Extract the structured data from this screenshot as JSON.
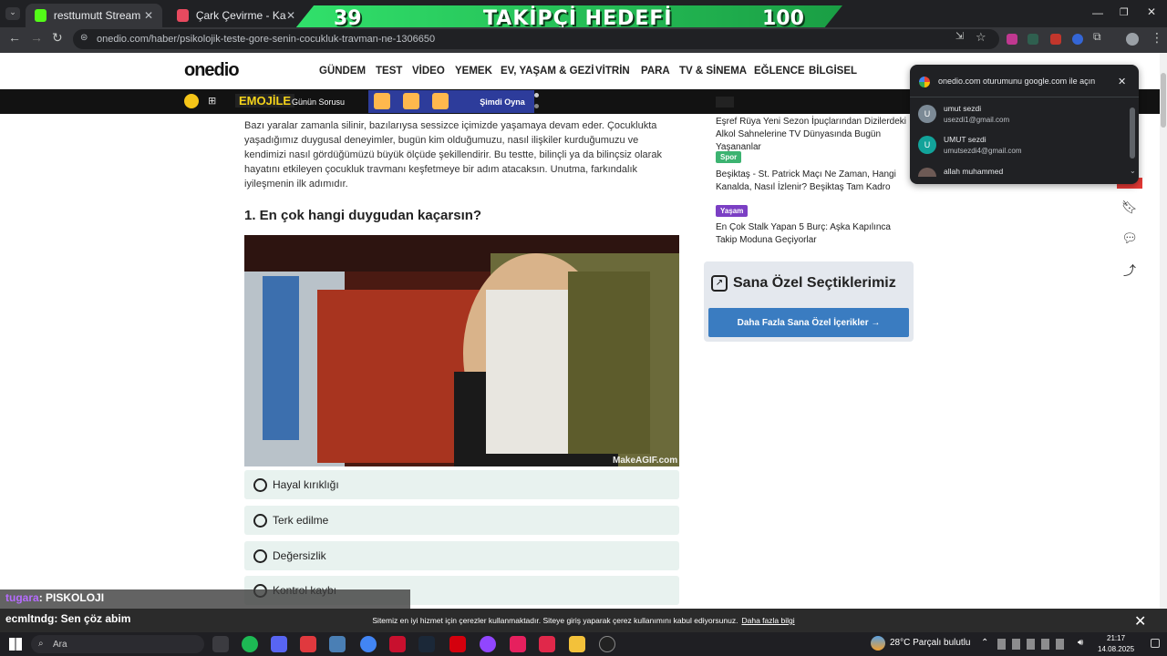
{
  "browser": {
    "tabs": [
      {
        "label": "resttumutt Stream - Watch Live",
        "favicon_color": "#53fc18"
      },
      {
        "label": "Çark Çevirme - Karar Çarkı",
        "favicon_color": "#e84a5f"
      }
    ],
    "url": "onedio.com/haber/psikolojik-teste-gore-senin-cocukluk-travman-ne-1306650"
  },
  "overlay": {
    "current": "39",
    "label": "TAKİPÇİ HEDEFİ",
    "target": "100"
  },
  "site": {
    "logo": "onedio",
    "nav": [
      "GÜNDEM",
      "TEST",
      "VİDEO",
      "YEMEK",
      "EV, YAŞAM & GEZİ",
      "VİTRİN",
      "PARA",
      "TV & SİNEMA",
      "EĞLENCE",
      "BİLGİSEL"
    ],
    "subbar": {
      "emojile": "EMOJİLE",
      "gunun": "Günün Sorusu",
      "play": "Şimdi Oyna"
    }
  },
  "article": {
    "intro": "Bazı yaralar zamanla silinir, bazılarıysa sessizce içimizde yaşamaya devam eder. Çocuklukta yaşadığımız duygusal deneyimler, bugün kim olduğumuzu, nasıl ilişkiler kurduğumuzu ve kendimizi nasıl gördüğümüzü büyük ölçüde şekillendirir. Bu testte, bilinçli ya da bilinçsiz olarak hayatını etkileyen çocukluk travmanı keşfetmeye bir adım atacaksın. Unutma, farkındalık iyileşmenin ilk adımıdır.",
    "question": "1. En çok hangi duygudan kaçarsın?",
    "photo_credit": "MakeAGIF.com",
    "options": [
      "Hayal kırıklığı",
      "Terk edilme",
      "Değersizlik",
      "Kontrol kaybı"
    ]
  },
  "sidebar": {
    "news": [
      {
        "tag": "",
        "title": "Eşref Rüya Yeni Sezon İpuçlarından Dizilerdeki Alkol Sahnelerine TV Dünyasında Bugün Yaşananlar"
      },
      {
        "tag": "Spor",
        "tag_color": "#3cb371",
        "title": "Beşiktaş - St. Patrick Maçı Ne Zaman, Hangi Kanalda, Nasıl İzlenir? Beşiktaş Tam Kadro"
      },
      {
        "tag": "Yaşam",
        "tag_color": "#7b3fc4",
        "title": "En Çok Stalk Yapan 5 Burç: Aşka Kapılınca Takip Moduna Geçiyorlar"
      }
    ],
    "picks_title": "Sana Özel Seçtiklerimiz",
    "picks_button": "Daha Fazla Sana Özel İçerikler →"
  },
  "google_popup": {
    "title": "onedio.com oturumunu google.com ile açın",
    "accounts": [
      {
        "initial": "U",
        "name": "umut sezdi",
        "email": "usezdi1@gmail.com",
        "color": "#7c8a96"
      },
      {
        "initial": "U",
        "name": "UMUT sezdi",
        "email": "umutsezdi4@gmail.com",
        "color": "#12a39a"
      },
      {
        "initial": "",
        "name": "allah muhammed",
        "email": "",
        "color": "#6d5a55"
      }
    ]
  },
  "chat": {
    "line1_user": "tugara",
    "line1_text": ": PISKOLOJI",
    "line2_user": "ecmltndg",
    "line2_text": ": Sen çöz abim"
  },
  "cookie": {
    "text": "Sitemiz en iyi hizmet için çerezler kullanmaktadır. Siteye giriş yaparak çerez kullanımını kabul ediyorsunuz.",
    "link": "Daha fazla bilgi"
  },
  "taskbar": {
    "search": "Ara",
    "weather": "28°C  Parçalı bulutlu",
    "time": "21:17",
    "date": "14.08.2025"
  }
}
